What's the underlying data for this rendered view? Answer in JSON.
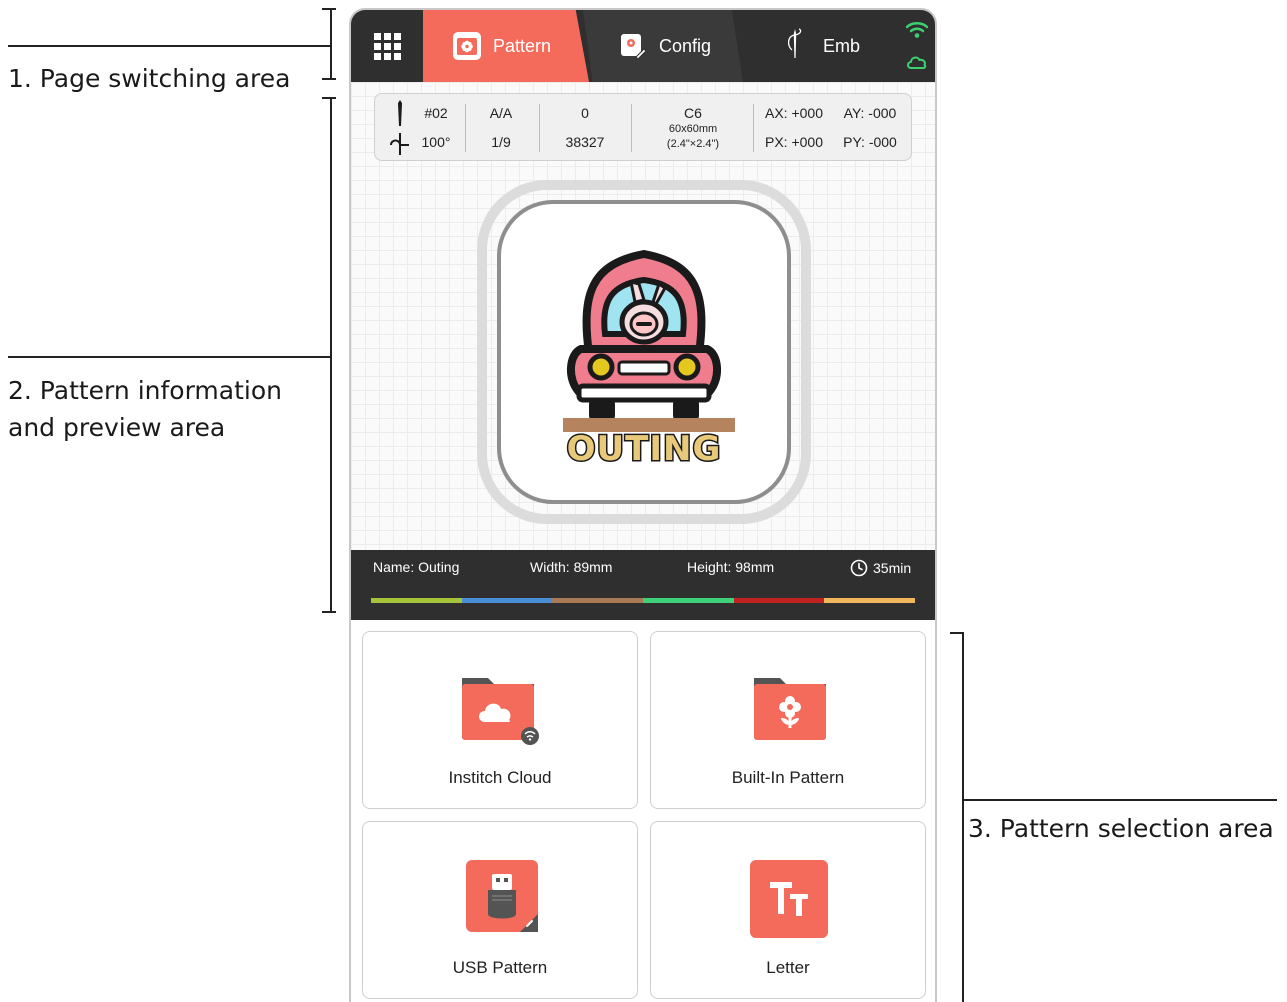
{
  "annotations": {
    "page_switching": "1. Page switching area",
    "pattern_info_line1": "2. Pattern information",
    "pattern_info_line2": "and preview area",
    "pattern_selection": "3. Pattern selection area"
  },
  "topbar": {
    "tabs": [
      {
        "label": "Pattern",
        "icon": "flower-card-icon",
        "active": true
      },
      {
        "label": "Config",
        "icon": "config-card-icon",
        "active": false
      },
      {
        "label": "Emb",
        "icon": "needle-thread-icon",
        "active": false
      }
    ],
    "status": [
      "wifi-icon",
      "cloud-icon"
    ],
    "colors": {
      "active": "#f46b5c",
      "bar": "#2f2f2f",
      "status_green": "#3bd16f"
    }
  },
  "info": {
    "needle": "#02",
    "angle": "100°",
    "aa": "A/A",
    "fraction": "1/9",
    "zero": "0",
    "stitches": "38327",
    "hoop": "C6",
    "hoop_mm": "60x60mm",
    "hoop_in": "(2.4\"×2.4\")",
    "ax": "AX: +000",
    "ay": "AY: -000",
    "px": "PX: +000",
    "py": "PY: -000"
  },
  "preview": {
    "design_text": "OUTING"
  },
  "details": {
    "name": "Name: Outing",
    "width": "Width: 89mm",
    "height": "Height: 98mm",
    "time": "35min",
    "thread_colors": [
      "#a6c43a",
      "#4a8fd6",
      "#a87a56",
      "#3fd07a",
      "#c02222",
      "#f0b85a"
    ]
  },
  "selection": {
    "cards": [
      {
        "label": "Institch Cloud",
        "icon": "cloud-folder-icon"
      },
      {
        "label": "Built-In Pattern",
        "icon": "flower-folder-icon"
      },
      {
        "label": "USB Pattern",
        "icon": "usb-icon"
      },
      {
        "label": "Letter",
        "icon": "letter-icon"
      }
    ],
    "accent": "#f46b5c"
  }
}
